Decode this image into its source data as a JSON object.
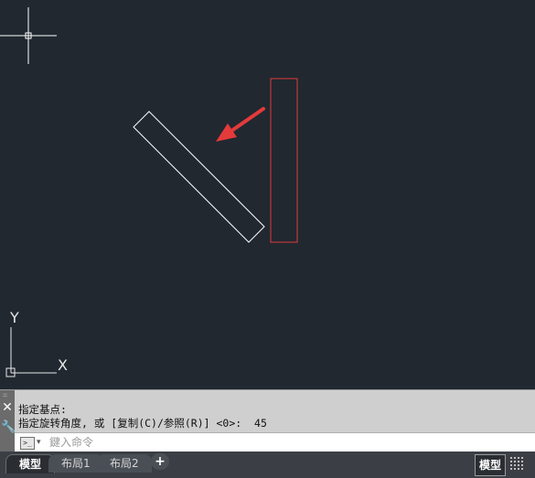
{
  "colors": {
    "canvas_bg": "#212830",
    "shape_white": "#ffffff",
    "shape_red": "#e03a3a",
    "arrow": "#e43a3a",
    "panel_bg": "#cfcfcf",
    "status_bg": "#3b3f45"
  },
  "canvas": {
    "crosshair_icon": "crosshair-cursor-icon",
    "ucs_icon": "ucs-axis-icon",
    "ucs_y_label": "Y",
    "ucs_x_label": "X",
    "shapes": [
      {
        "name": "rotated-rectangle",
        "color": "white",
        "rotation_degrees": 45
      },
      {
        "name": "original-rectangle",
        "color": "red"
      }
    ],
    "annotation": "red-pointer-arrow"
  },
  "command_panel": {
    "close_icon": "close-icon",
    "settings_icon": "wrench-icon",
    "history": [
      "指定基点:",
      "指定旋转角度, 或 [复制(C)/参照(R)] <0>:  45"
    ],
    "prompt_icon": "command-prompt-icon",
    "prompt_symbol": ">_",
    "input": {
      "value": "",
      "placeholder": "鍵入命令"
    }
  },
  "status_bar": {
    "tabs": [
      {
        "label": "模型",
        "active": true
      },
      {
        "label": "布局1",
        "active": false
      },
      {
        "label": "布局2",
        "active": false
      }
    ],
    "add_tab_label": "+",
    "model_toggle_label": "模型",
    "grid_icon": "grid-icon"
  }
}
